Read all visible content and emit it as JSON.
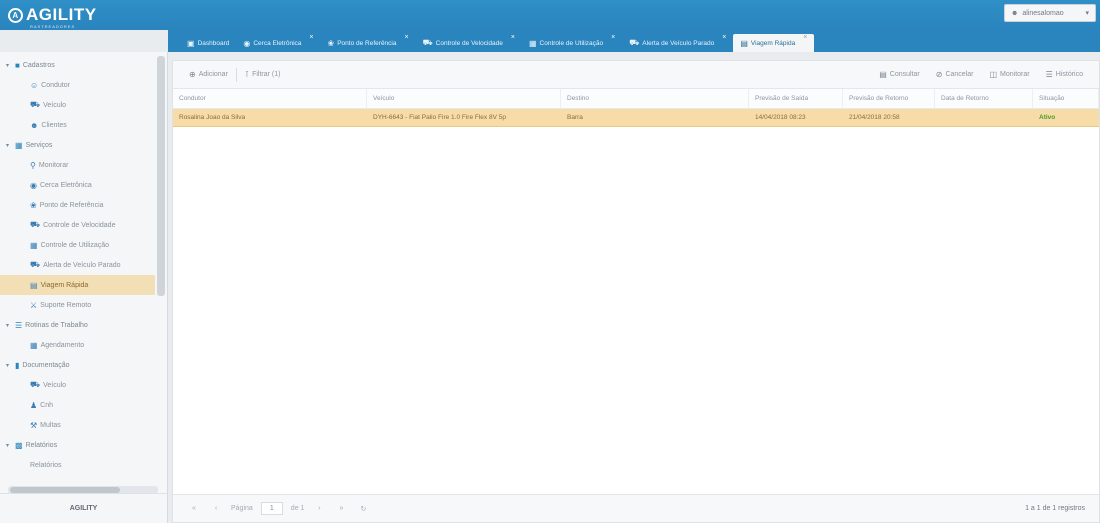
{
  "app": {
    "logo_text": "AGILITY",
    "logo_sub": "RASTREADORES",
    "user": "alinesalomao",
    "footer": "AGILITY"
  },
  "tabs": [
    {
      "label": "Dashboard",
      "icon": "monitor-icon"
    },
    {
      "label": "Cerca Eletrônica",
      "icon": "lock-icon"
    },
    {
      "label": "Ponto de Referência",
      "icon": "globe-icon"
    },
    {
      "label": "Controle de Velocidade",
      "icon": "car-icon"
    },
    {
      "label": "Controle de Utilização",
      "icon": "calendar-icon"
    },
    {
      "label": "Alerta de Veículo Parado",
      "icon": "car-icon"
    },
    {
      "label": "Viagem Rápida",
      "icon": "clipboard-icon"
    }
  ],
  "sidebar": {
    "cadastros": {
      "label": "Cadastros",
      "items": [
        "Condutor",
        "Veículo",
        "Clientes"
      ]
    },
    "servicos": {
      "label": "Serviços",
      "items": [
        "Monitorar",
        "Cerca Eletrônica",
        "Ponto de Referência",
        "Controle de Velocidade",
        "Controle de Utilização",
        "Alerta de Veículo Parado",
        "Viagem Rápida",
        "Suporte Remoto"
      ]
    },
    "rotinas": {
      "label": "Rotinas de Trabalho",
      "items": [
        "Agendamento"
      ]
    },
    "documentacao": {
      "label": "Documentação",
      "items": [
        "Veículo",
        "Cnh",
        "Multas"
      ]
    },
    "relatorios": {
      "label": "Relatórios",
      "items": [
        "Relatórios"
      ]
    }
  },
  "toolbar": {
    "add": "Adicionar",
    "filter": "Filtrar (1)",
    "consult": "Consultar",
    "cancel": "Cancelar",
    "monitor": "Monitorar",
    "history": "Histórico"
  },
  "table": {
    "headers": [
      "Condutor",
      "Veículo",
      "Destino",
      "Previsão de Saída",
      "Previsão de Retorno",
      "Data de Retorno",
      "Situação"
    ],
    "rows": [
      [
        "Rosalina Joao da Silva",
        "DYH-6643 - Fiat Palio Fire 1.0 Fire Flex 8V 5p",
        "Barra",
        "14/04/2018 08:23",
        "21/04/2018 20:58",
        "",
        "Ativo"
      ]
    ]
  },
  "pager": {
    "page_label": "Página",
    "page_value": "1",
    "of_label": "de 1",
    "info": "1 a 1 de 1 registros"
  }
}
